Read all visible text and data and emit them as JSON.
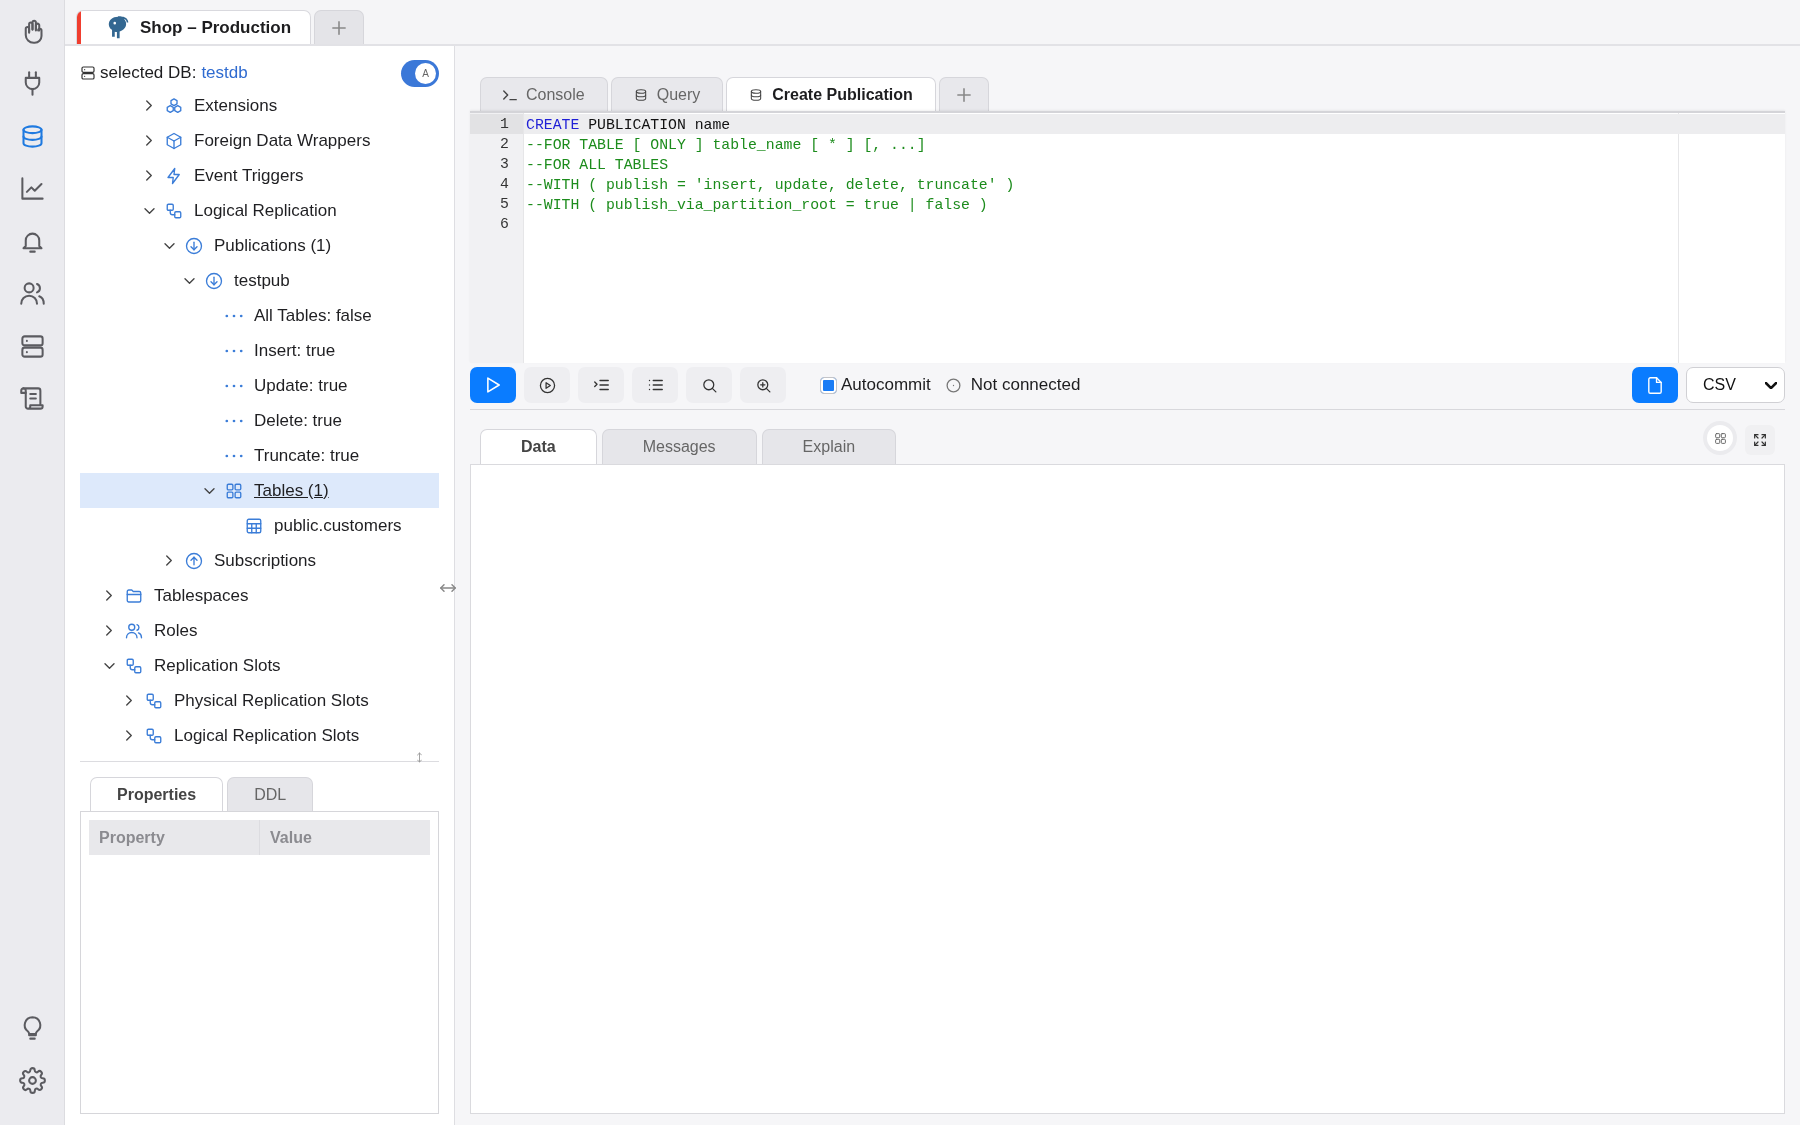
{
  "rail": [
    {
      "kind": "hand",
      "selected": false
    },
    {
      "kind": "plug",
      "selected": false
    },
    {
      "kind": "database",
      "selected": true
    },
    {
      "kind": "chart",
      "selected": false
    },
    {
      "kind": "bell",
      "selected": false
    },
    {
      "kind": "users",
      "selected": false
    },
    {
      "kind": "servers",
      "selected": false
    },
    {
      "kind": "scroll",
      "selected": false
    }
  ],
  "rail_bottom": [
    {
      "kind": "bulb"
    },
    {
      "kind": "gear"
    }
  ],
  "connection_tabs": [
    {
      "label": "Shop – Production",
      "color": "#f03e2f",
      "selected": true
    }
  ],
  "tree_panel": {
    "selected_db": {
      "label": "selected DB:",
      "name": "testdb"
    },
    "sort_switch": {
      "on": true,
      "knob_label": "A"
    },
    "tree": {
      "scrolled_branch": [
        {
          "label": "Extensions",
          "kind": "extensions",
          "expanded": false,
          "selected": false
        },
        {
          "label": "Foreign Data Wrappers",
          "kind": "wrappers",
          "expanded": false,
          "selected": false
        },
        {
          "label": "Event Triggers",
          "kind": "triggers",
          "expanded": false,
          "selected": false
        },
        {
          "label": "Logical Replication",
          "kind": "replication",
          "expanded": true,
          "selected": false,
          "children": [
            {
              "label": "Publications (1)",
              "kind": "publication",
              "expanded": true,
              "selected": false,
              "children": [
                {
                  "label": "testpub",
                  "kind": "publication",
                  "expanded": true,
                  "selected": false,
                  "children": [
                    {
                      "label": "All Tables: false",
                      "kind": "property",
                      "selected": false
                    },
                    {
                      "label": "Insert: true",
                      "kind": "property",
                      "selected": false
                    },
                    {
                      "label": "Update: true",
                      "kind": "property",
                      "selected": false
                    },
                    {
                      "label": "Delete: true",
                      "kind": "property",
                      "selected": false
                    },
                    {
                      "label": "Truncate: true",
                      "kind": "property",
                      "selected": false
                    },
                    {
                      "label": "Tables (1)",
                      "kind": "tables",
                      "expanded": true,
                      "selected": true,
                      "children": [
                        {
                          "label": "public.customers",
                          "kind": "table",
                          "selected": false
                        }
                      ]
                    }
                  ]
                }
              ]
            },
            {
              "label": "Subscriptions",
              "kind": "subscription",
              "expanded": false,
              "selected": false
            }
          ]
        }
      ],
      "items": [
        {
          "label": "Tablespaces",
          "kind": "tablespaces",
          "expanded": false,
          "selected": false
        },
        {
          "label": "Roles",
          "kind": "roles",
          "expanded": false,
          "selected": false
        },
        {
          "label": "Replication Slots",
          "kind": "replication",
          "expanded": true,
          "selected": false,
          "children": [
            {
              "label": "Physical Replication Slots",
              "kind": "replication",
              "expanded": false,
              "selected": false
            },
            {
              "label": "Logical Replication Slots",
              "kind": "replication",
              "expanded": false,
              "selected": false
            }
          ]
        }
      ]
    }
  },
  "properties_panel": {
    "tabs": [
      {
        "label": "Properties",
        "selected": true
      },
      {
        "label": "DDL",
        "selected": false
      }
    ],
    "columns": [
      "Property",
      "Value"
    ]
  },
  "editor_tabs": [
    {
      "label": "Console",
      "kind": "console",
      "selected": false
    },
    {
      "label": "Query",
      "kind": "query",
      "selected": false
    },
    {
      "label": "Create Publication",
      "kind": "query",
      "selected": true
    }
  ],
  "editor": {
    "lines": [
      {
        "number": "1",
        "current": true,
        "tokens": [
          {
            "text": "CREATE",
            "kind": "keyword"
          },
          {
            "text": " PUBLICATION name",
            "kind": "plain"
          }
        ]
      },
      {
        "number": "2",
        "current": false,
        "tokens": [
          {
            "text": "--FOR TABLE [ ONLY ] table_name [ * ] [, ...]",
            "kind": "comment"
          }
        ]
      },
      {
        "number": "3",
        "current": false,
        "tokens": [
          {
            "text": "--FOR ALL TABLES",
            "kind": "comment"
          }
        ]
      },
      {
        "number": "4",
        "current": false,
        "tokens": [
          {
            "text": "--WITH ( publish = 'insert, update, delete, truncate' )",
            "kind": "comment"
          }
        ]
      },
      {
        "number": "5",
        "current": false,
        "tokens": [
          {
            "text": "--WITH ( publish_via_partition_root = true | false )",
            "kind": "comment"
          }
        ]
      },
      {
        "number": "6",
        "current": false
      }
    ]
  },
  "toolbar": {
    "autocommit": {
      "label": "Autocommit",
      "checked": true
    },
    "status": "Not connected",
    "export_format": "CSV"
  },
  "result_tabs": [
    {
      "label": "Data",
      "selected": true
    },
    {
      "label": "Messages",
      "selected": false
    },
    {
      "label": "Explain",
      "selected": false
    }
  ]
}
